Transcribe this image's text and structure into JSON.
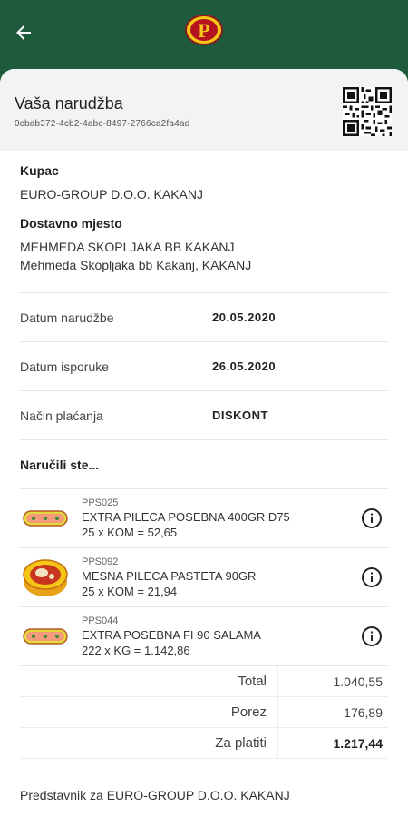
{
  "header": {
    "back_icon": "arrow-left-icon",
    "logo_letter": "P",
    "brand_color": "#1e5a3c"
  },
  "order": {
    "title": "Vaša narudžba",
    "id": "0cbab372-4cb2-4abc-8497-2766ca2fa4ad"
  },
  "customer": {
    "label": "Kupac",
    "name": "EURO-GROUP D.O.O. KAKANJ",
    "delivery_label": "Dostavno mjesto",
    "delivery_line1": "MEHMEDA SKOPLJAKA  BB KAKANJ",
    "delivery_line2": "Mehmeda Skopljaka  bb Kakanj, KAKANJ"
  },
  "details": [
    {
      "label": "Datum narudžbe",
      "value": "20.05.2020"
    },
    {
      "label": "Datum isporuke",
      "value": "26.05.2020"
    },
    {
      "label": "Način plaćanja",
      "value": "DISKONT"
    }
  ],
  "items_label": "Naručili ste...",
  "items": [
    {
      "code": "PPS025",
      "name": "EXTRA PILECA POSEBNA 400GR D75",
      "qty": "25 x KOM = 52,65",
      "icon": "sausage-icon"
    },
    {
      "code": "PPS092",
      "name": "MESNA PILECA PASTETA 90GR",
      "qty": "25 x KOM = 21,94",
      "icon": "pate-tin-icon"
    },
    {
      "code": "PPS044",
      "name": "EXTRA POSEBNA FI 90 SALAMA",
      "qty": "222 x KG = 1.142,86",
      "icon": "sausage-icon"
    }
  ],
  "totals": [
    {
      "label": "Total",
      "value": "1.040,55"
    },
    {
      "label": "Porez",
      "value": "176,89"
    },
    {
      "label": "Za platiti",
      "value": "1.217,44"
    }
  ],
  "footer": "Predstavnik za EURO-GROUP D.O.O. KAKANJ"
}
